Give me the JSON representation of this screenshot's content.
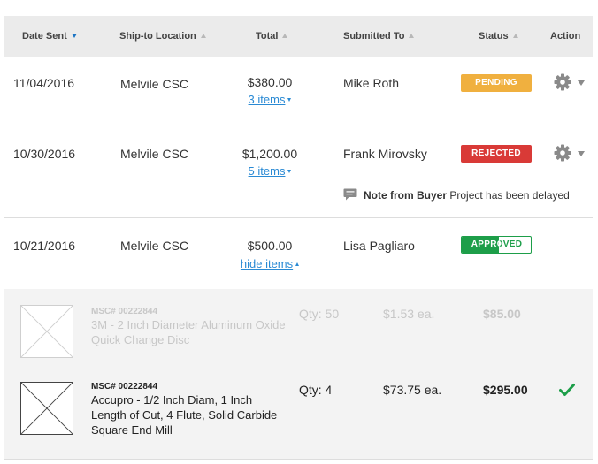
{
  "table": {
    "columns": [
      {
        "label": "Date Sent",
        "sort": "desc"
      },
      {
        "label": "Ship-to Location",
        "sort": "none"
      },
      {
        "label": "Total",
        "sort": "none"
      },
      {
        "label": "Submitted To",
        "sort": "none"
      },
      {
        "label": "Status",
        "sort": "none"
      },
      {
        "label": "Action",
        "sort": "none"
      }
    ],
    "rows": [
      {
        "date": "11/04/2016",
        "location": "Melvile CSC",
        "total": "$380.00",
        "items_link": "3 items",
        "submitted_to": "Mike Roth",
        "status": "PENDING",
        "action_icon": "gear-icon"
      },
      {
        "date": "10/30/2016",
        "location": "Melvile CSC",
        "total": "$1,200.00",
        "items_link": "5 items",
        "submitted_to": "Frank Mirovsky",
        "status": "REJECTED",
        "action_icon": "gear-icon",
        "note": {
          "label": "Note from Buyer",
          "text": "Project has been delayed",
          "icon": "comment-icon"
        }
      },
      {
        "date": "10/21/2016",
        "location": "Melvile CSC",
        "total": "$500.00",
        "items_link": "hide items",
        "submitted_to": "Lisa Pagliaro",
        "status": "APPROVED",
        "status_progress": 0.54
      }
    ]
  },
  "line_items": [
    {
      "sku": "MSC# 00222844",
      "name": "3M - 2 Inch Diameter Aluminum Oxide Quick Change Disc",
      "qty": "Qty: 50",
      "each": "$1.53 ea.",
      "price": "$85.00",
      "faded": true
    },
    {
      "sku": "MSC# 00222844",
      "name": "Accupro - 1/2 Inch Diam, 1 Inch Length of Cut, 4 Flute, Solid Carbide Square End Mill",
      "qty": "Qty: 4",
      "each": "$73.75 ea.",
      "price": "$295.00",
      "faded": false,
      "approved_icon": "checkmark-icon"
    }
  ],
  "colors": {
    "pending": "#f0b03f",
    "rejected": "#d93a37",
    "approved": "#1d9e49",
    "link": "#2a8ad4",
    "sort_active": "#1b74c4"
  }
}
